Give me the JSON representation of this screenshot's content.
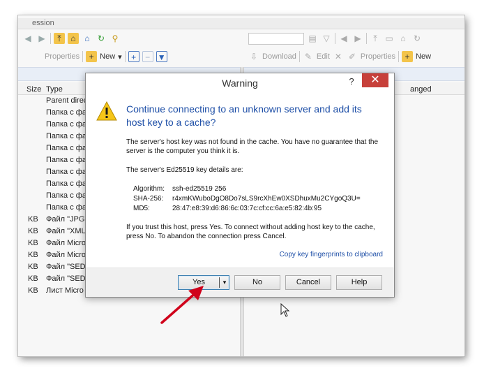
{
  "app": {
    "title_fragment": "ession",
    "left_toolbar2": {
      "properties": "Properties",
      "new": "New",
      "new_dropdown": "▾"
    },
    "right_toolbar2": {
      "download": "Download",
      "edit": "Edit",
      "properties": "Properties",
      "new": "New"
    },
    "left_headers": {
      "size": "Size",
      "type": "Type"
    },
    "right_headers": {
      "changed": "anged"
    },
    "files": [
      {
        "size": "",
        "type": "Parent direc"
      },
      {
        "size": "",
        "type": "Папка с фа"
      },
      {
        "size": "",
        "type": "Папка с фа"
      },
      {
        "size": "",
        "type": "Папка с фа"
      },
      {
        "size": "",
        "type": "Папка с фа"
      },
      {
        "size": "",
        "type": "Папка с фа"
      },
      {
        "size": "",
        "type": "Папка с фа"
      },
      {
        "size": "",
        "type": "Папка с фа"
      },
      {
        "size": "",
        "type": "Папка с фа"
      },
      {
        "size": "",
        "type": "Папка с фа"
      },
      {
        "size": "KB",
        "type": "Файл \"JPG\""
      },
      {
        "size": "KB",
        "type": "Файл \"XML"
      },
      {
        "size": "KB",
        "type": "Файл Micro"
      },
      {
        "size": "KB",
        "type": "Файл Micro"
      },
      {
        "size": "KB",
        "type": "Файл \"SEDE"
      },
      {
        "size": "KB",
        "type": "Файл \"SEDE"
      },
      {
        "size": "KB",
        "type": "Лист Micro"
      }
    ]
  },
  "dialog": {
    "title": "Warning",
    "help_glyph": "?",
    "close_glyph": "✕",
    "heading": "Continue connecting to an unknown server and add its host key to a cache?",
    "para1": "The server's host key was not found in the cache. You have no guarantee that the server is the computer you think it is.",
    "para2": "The server's Ed25519 key details are:",
    "details": [
      {
        "key": "Algorithm:",
        "value": "ssh-ed25519 256"
      },
      {
        "key": "SHA-256:",
        "value": "r4xmKWuboDgO8Do7sLS9rcXhEw0XSDhuxMu2CYgoQ3U="
      },
      {
        "key": "MD5:",
        "value": "28:47:e8:39:d6:86:6c:03:7c:cf:cc:6a:e5:82:4b:95"
      }
    ],
    "para3": "If you trust this host, press Yes. To connect without adding host key to the cache, press No. To abandon the connection press Cancel.",
    "copy_link": "Copy key fingerprints to clipboard",
    "buttons": {
      "yes": "Yes",
      "yes_drop": "▾",
      "no": "No",
      "cancel": "Cancel",
      "help": "Help"
    }
  },
  "colors": {
    "heading": "#1e4fa7",
    "close": "#c7403a",
    "arrow": "#d0021b",
    "yes_border": "#3c7fb1"
  }
}
